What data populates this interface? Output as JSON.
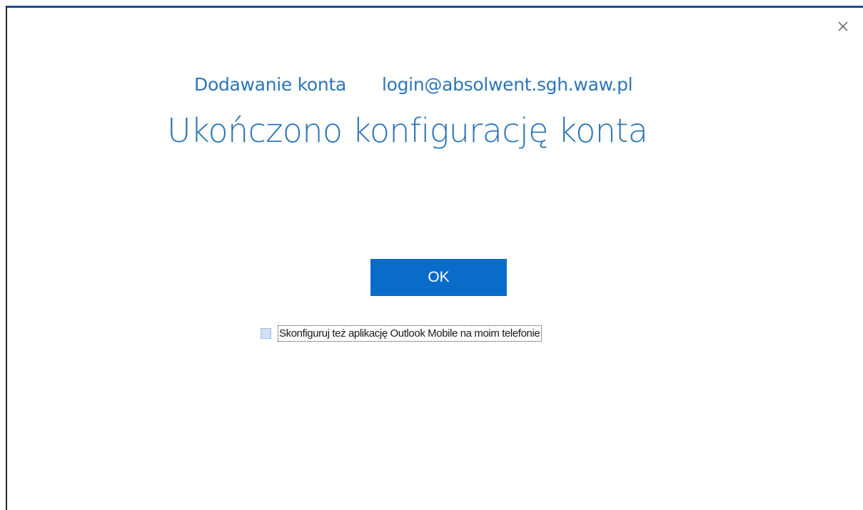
{
  "header": {
    "action_label": "Dodawanie konta",
    "account_email": "login@absolwent.sgh.waw.pl"
  },
  "main": {
    "title": "Ukończono konfigurację konta",
    "ok_label": "OK",
    "mobile_checkbox": {
      "label": "Skonfiguruj też aplikację Outlook Mobile na moim telefonie",
      "checked": false
    }
  },
  "icons": {
    "close": "close-icon"
  },
  "colors": {
    "accent_text": "#2e75b6",
    "primary_button": "#0a6cc9",
    "frame_top": "#1f4e8c"
  }
}
